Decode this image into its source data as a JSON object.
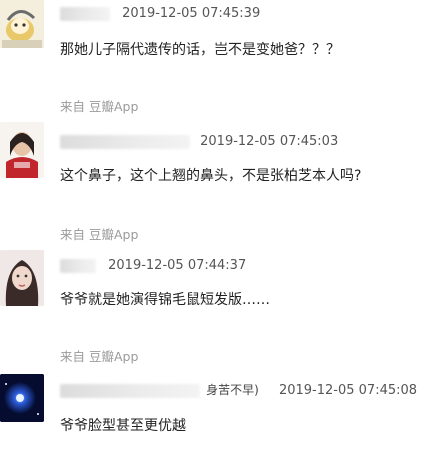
{
  "comments": [
    {
      "handle_visible": "",
      "timestamp": "2019-12-05  07:45:39",
      "text": "那她儿子隔代遗传的话，岂不是变她爸？？？",
      "source": "来自 豆瓣App"
    },
    {
      "handle_visible": "",
      "timestamp": "2019-12-05  07:45:03",
      "text": "这个鼻子，这个上翘的鼻头，不是张柏芝本人吗?",
      "source": "来自 豆瓣App"
    },
    {
      "handle_visible": "",
      "timestamp": "2019-12-05  07:44:37",
      "text": "爷爷就是她演得锦毛鼠短发版……",
      "source": "来自 豆瓣App"
    },
    {
      "handle_visible": "身苦不早)",
      "timestamp": "2019-12-05  07:45:08",
      "text": "爷爷脸型甚至更优越",
      "source": ""
    }
  ]
}
